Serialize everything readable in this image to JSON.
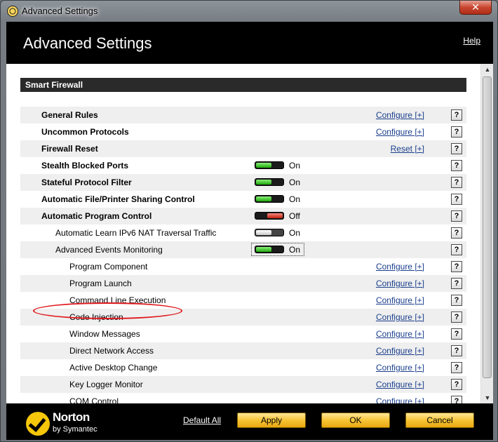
{
  "window": {
    "title": "Advanced Settings",
    "close_glyph": "✕"
  },
  "header": {
    "title": "Advanced Settings",
    "help": "Help"
  },
  "section": {
    "title": "Smart Firewall"
  },
  "rows": [
    {
      "label": "General Rules",
      "level": 1,
      "link": "Configure [+]"
    },
    {
      "label": "Uncommon Protocols",
      "level": 1,
      "link": "Configure [+]"
    },
    {
      "label": "Firewall Reset",
      "level": 1,
      "link": "Reset [+]"
    },
    {
      "label": "Stealth Blocked Ports",
      "level": 1,
      "toggle": "on",
      "state": "On"
    },
    {
      "label": "Stateful Protocol Filter",
      "level": 1,
      "toggle": "on",
      "state": "On"
    },
    {
      "label": "Automatic File/Printer Sharing Control",
      "level": 1,
      "toggle": "on",
      "state": "On"
    },
    {
      "label": "Automatic Program Control",
      "level": 1,
      "toggle": "off",
      "state": "Off"
    },
    {
      "label": "Automatic Learn IPv6 NAT Traversal Traffic",
      "level": 2,
      "toggle": "grey",
      "state": "On"
    },
    {
      "label": "Advanced Events Monitoring",
      "level": 2,
      "toggle": "on",
      "state": "On",
      "focused": true
    },
    {
      "label": "Program Component",
      "level": 3,
      "link": "Configure [+]"
    },
    {
      "label": "Program Launch",
      "level": 3,
      "link": "Configure [+]"
    },
    {
      "label": "Command Line Execution",
      "level": 3,
      "link": "Configure [+]"
    },
    {
      "label": "Code Injection",
      "level": 3,
      "link": "Configure [+]"
    },
    {
      "label": "Window Messages",
      "level": 3,
      "link": "Configure [+]"
    },
    {
      "label": "Direct Network Access",
      "level": 3,
      "link": "Configure [+]"
    },
    {
      "label": "Active Desktop Change",
      "level": 3,
      "link": "Configure [+]"
    },
    {
      "label": "Key Logger Monitor",
      "level": 3,
      "link": "Configure [+]"
    },
    {
      "label": "COM Control",
      "level": 3,
      "link": "Configure [+]"
    }
  ],
  "help_glyph": "?",
  "footer": {
    "logo_name": "Norton",
    "logo_sub": "by Symantec",
    "default_all": "Default All",
    "apply": "Apply",
    "ok": "OK",
    "cancel": "Cancel"
  },
  "colors": {
    "toggle_on": "#1ea80c",
    "toggle_off": "#c3200f",
    "link": "#1a3e8c",
    "button": "#f7c436",
    "highlight": "#e0191e"
  }
}
